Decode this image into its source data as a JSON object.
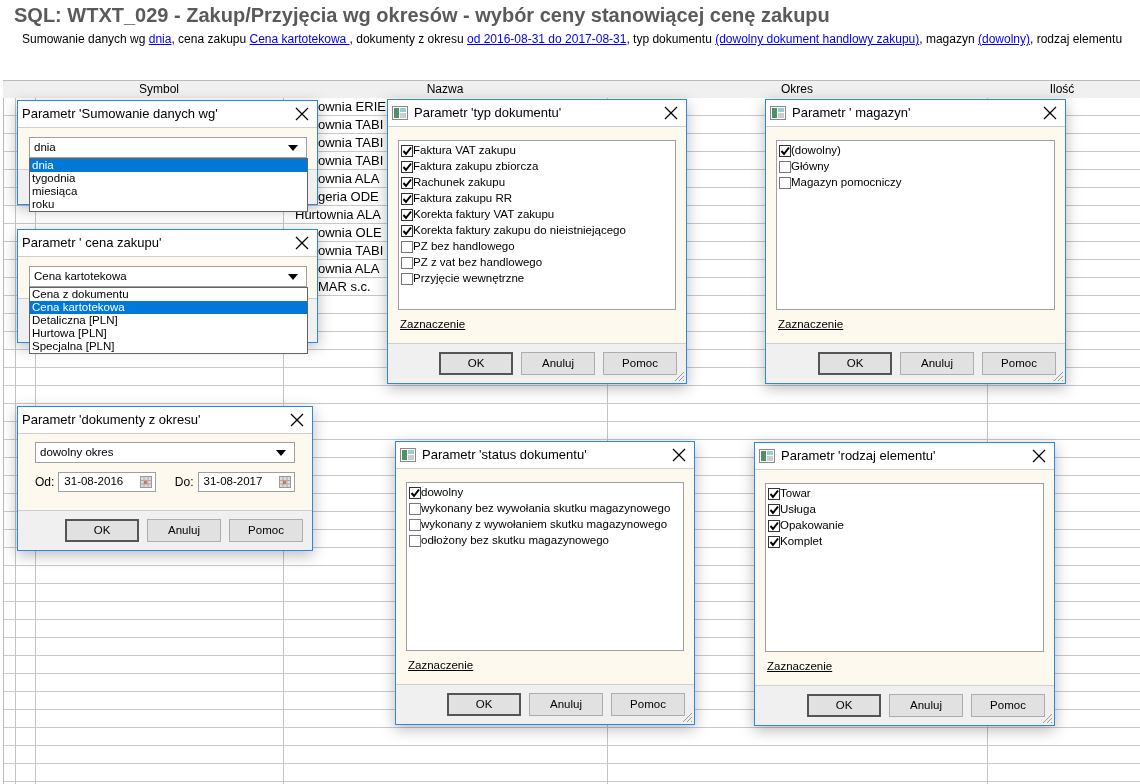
{
  "title": "SQL: WTXT_029 - Zakup/Przyjęcia wg okresów - wybór ceny stanowiącej cenę zakupu",
  "summary": [
    {
      "kind": "text",
      "text": "Sumowanie danych wg "
    },
    {
      "kind": "link",
      "text": "dnia"
    },
    {
      "kind": "text",
      "text": ", cena zakupu "
    },
    {
      "kind": "link",
      "text": "Cena kartotekowa "
    },
    {
      "kind": "text",
      "text": ", dokumenty z okresu "
    },
    {
      "kind": "link",
      "text": "od 2016-08-31 do 2017-08-31"
    },
    {
      "kind": "text",
      "text": ", typ dokumentu "
    },
    {
      "kind": "link",
      "text": "(dowolny dokument handlowy zakupu)"
    },
    {
      "kind": "text",
      "text": ", magazyn "
    },
    {
      "kind": "link",
      "text": "(dowolny)"
    },
    {
      "kind": "text",
      "text": ", rodzaj elementu"
    }
  ],
  "table": {
    "columns": [
      "Symbol",
      "Nazwa",
      "Okres",
      "Ilość"
    ],
    "rows": [
      {
        "nazwa": "ownia ERIE",
        "kind": "partial"
      },
      {
        "nazwa": "ownia TABI",
        "kind": "partial"
      },
      {
        "nazwa": "ownia TABI",
        "kind": "partial"
      },
      {
        "nazwa": "ownia TABI",
        "kind": "partial"
      },
      {
        "nazwa": "ownia ALA",
        "kind": "partial"
      },
      {
        "nazwa": "geria ODE",
        "kind": "partial"
      },
      {
        "nazwa": "Hurtownia ALA",
        "kind": "full"
      },
      {
        "nazwa": "ownia OLE",
        "kind": "partial"
      },
      {
        "nazwa": "ownia TABI",
        "kind": "partial"
      },
      {
        "nazwa": "ownia ALA",
        "kind": "partial"
      },
      {
        "nazwa": "MAR s.c.",
        "kind": "partial"
      }
    ]
  },
  "dialogs": [
    {
      "kind": "dropdown",
      "title": "Parametr 'Sumowanie danych wg'",
      "icon": false,
      "value": "dnia",
      "options": [
        {
          "label": "dnia",
          "selected": true
        },
        {
          "label": "tygodnia",
          "selected": false
        },
        {
          "label": "miesiąca",
          "selected": false
        },
        {
          "label": "roku",
          "selected": false
        }
      ]
    },
    {
      "kind": "checklist",
      "title": "Parametr 'typ dokumentu'",
      "icon": true,
      "items": [
        {
          "label": "Faktura VAT zakupu",
          "checked": true
        },
        {
          "label": "Faktura zakupu zbiorcza",
          "checked": true
        },
        {
          "label": "Rachunek zakupu",
          "checked": true
        },
        {
          "label": "Faktura zakupu RR",
          "checked": true
        },
        {
          "label": "Korekta faktury VAT zakupu",
          "checked": true
        },
        {
          "label": "Korekta faktury zakupu do nieistniejącego",
          "checked": true
        },
        {
          "label": "PZ bez handlowego",
          "checked": false
        },
        {
          "label": "PZ z vat bez handlowego",
          "checked": false
        },
        {
          "label": "Przyjęcie wewnętrzne",
          "checked": false
        }
      ],
      "link": "Zaznaczenie",
      "buttons": [
        {
          "label": "OK",
          "default": true
        },
        {
          "label": "Anuluj",
          "default": false
        },
        {
          "label": "Pomoc",
          "default": false
        }
      ]
    },
    {
      "kind": "checklist",
      "title": "Parametr ' magazyn'",
      "icon": true,
      "items": [
        {
          "label": "(dowolny)",
          "checked": true
        },
        {
          "label": "Główny",
          "checked": false
        },
        {
          "label": "Magazyn pomocniczy",
          "checked": false
        }
      ],
      "link": "Zaznaczenie",
      "buttons": [
        {
          "label": "OK",
          "default": true
        },
        {
          "label": "Anuluj",
          "default": false
        },
        {
          "label": "Pomoc",
          "default": false
        }
      ]
    },
    {
      "kind": "dropdown",
      "title": "Parametr ' cena zakupu'",
      "icon": false,
      "value": "Cena kartotekowa",
      "options": [
        {
          "label": "Cena z dokumentu",
          "selected": false
        },
        {
          "label": "Cena kartotekowa",
          "selected": true
        },
        {
          "label": "Detaliczna [PLN]",
          "selected": false
        },
        {
          "label": "Hurtowa [PLN]",
          "selected": false
        },
        {
          "label": "Specjalna [PLN]",
          "selected": false
        }
      ]
    },
    {
      "kind": "period",
      "title": "Parametr 'dokumenty z okresu'",
      "icon": false,
      "value": "dowolny okres",
      "from_label": "Od:",
      "from_value": "31-08-2016",
      "to_label": "Do:",
      "to_value": "31-08-2017",
      "buttons": [
        {
          "label": "OK",
          "default": true
        },
        {
          "label": "Anuluj",
          "default": false
        },
        {
          "label": "Pomoc",
          "default": false
        }
      ]
    },
    {
      "kind": "checklist",
      "title": "Parametr 'status dokumentu'",
      "icon": true,
      "items": [
        {
          "label": "dowolny",
          "checked": true
        },
        {
          "label": "wykonany bez wywołania skutku magazynowego",
          "checked": false
        },
        {
          "label": "wykonany z wywołaniem skutku magazynowego",
          "checked": false
        },
        {
          "label": "odłożony bez skutku magazynowego",
          "checked": false
        }
      ],
      "link": "Zaznaczenie",
      "buttons": [
        {
          "label": "OK",
          "default": true
        },
        {
          "label": "Anuluj",
          "default": false
        },
        {
          "label": "Pomoc",
          "default": false
        }
      ]
    },
    {
      "kind": "checklist",
      "title": "Parametr 'rodzaj elementu'",
      "icon": true,
      "items": [
        {
          "label": "Towar",
          "checked": true
        },
        {
          "label": "Usługa",
          "checked": true
        },
        {
          "label": "Opakowanie",
          "checked": true
        },
        {
          "label": "Komplet",
          "checked": true
        }
      ],
      "link": "Zaznaczenie",
      "buttons": [
        {
          "label": "OK",
          "default": true
        },
        {
          "label": "Anuluj",
          "default": false
        },
        {
          "label": "Pomoc",
          "default": false
        }
      ]
    }
  ]
}
